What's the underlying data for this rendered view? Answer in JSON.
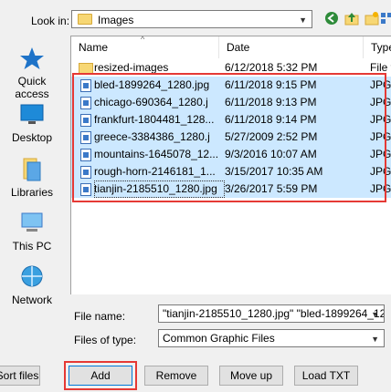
{
  "look_in": {
    "label": "Look in:",
    "value": "Images"
  },
  "places": [
    {
      "label": "Quick access",
      "icon": "quick-access-star-icon"
    },
    {
      "label": "Desktop",
      "icon": "desktop-icon"
    },
    {
      "label": "Libraries",
      "icon": "libraries-icon"
    },
    {
      "label": "This PC",
      "icon": "this-pc-icon"
    },
    {
      "label": "Network",
      "icon": "network-icon"
    }
  ],
  "columns": {
    "name": "Name",
    "date": "Date",
    "type": "Type"
  },
  "files": [
    {
      "name": "resized-images",
      "date": "6/12/2018 5:32 PM",
      "type": "File f",
      "kind": "folder",
      "selected": false
    },
    {
      "name": "bled-1899264_1280.jpg",
      "date": "6/11/2018 9:15 PM",
      "type": "JPG",
      "kind": "file",
      "selected": true
    },
    {
      "name": "chicago-690364_1280.j",
      "date": "6/11/2018 9:13 PM",
      "type": "JPG",
      "kind": "file",
      "selected": true
    },
    {
      "name": "frankfurt-1804481_128...",
      "date": "6/11/2018 9:14 PM",
      "type": "JPG",
      "kind": "file",
      "selected": true
    },
    {
      "name": "greece-3384386_1280.j",
      "date": "5/27/2009 2:52 PM",
      "type": "JPG",
      "kind": "file",
      "selected": true
    },
    {
      "name": "mountains-1645078_12...",
      "date": "9/3/2016 10:07 AM",
      "type": "JPG",
      "kind": "file",
      "selected": true
    },
    {
      "name": "rough-horn-2146181_1...",
      "date": "3/15/2017 10:35 AM",
      "type": "JPG",
      "kind": "file",
      "selected": true
    },
    {
      "name": "tianjin-2185510_1280.jpg",
      "date": "3/26/2017 5:59 PM",
      "type": "JPG",
      "kind": "file",
      "selected": true
    }
  ],
  "file_name": {
    "label": "File name:",
    "value": "\"tianjin-2185510_1280.jpg\" \"bled-1899264_128"
  },
  "file_type": {
    "label": "Files of type:",
    "value": "Common Graphic Files"
  },
  "buttons": {
    "sort": "Sort files",
    "add": "Add",
    "remove": "Remove",
    "move_up": "Move up",
    "load_txt": "Load TXT"
  },
  "colors": {
    "selection": "#cce8ff",
    "highlight": "#e53935"
  }
}
